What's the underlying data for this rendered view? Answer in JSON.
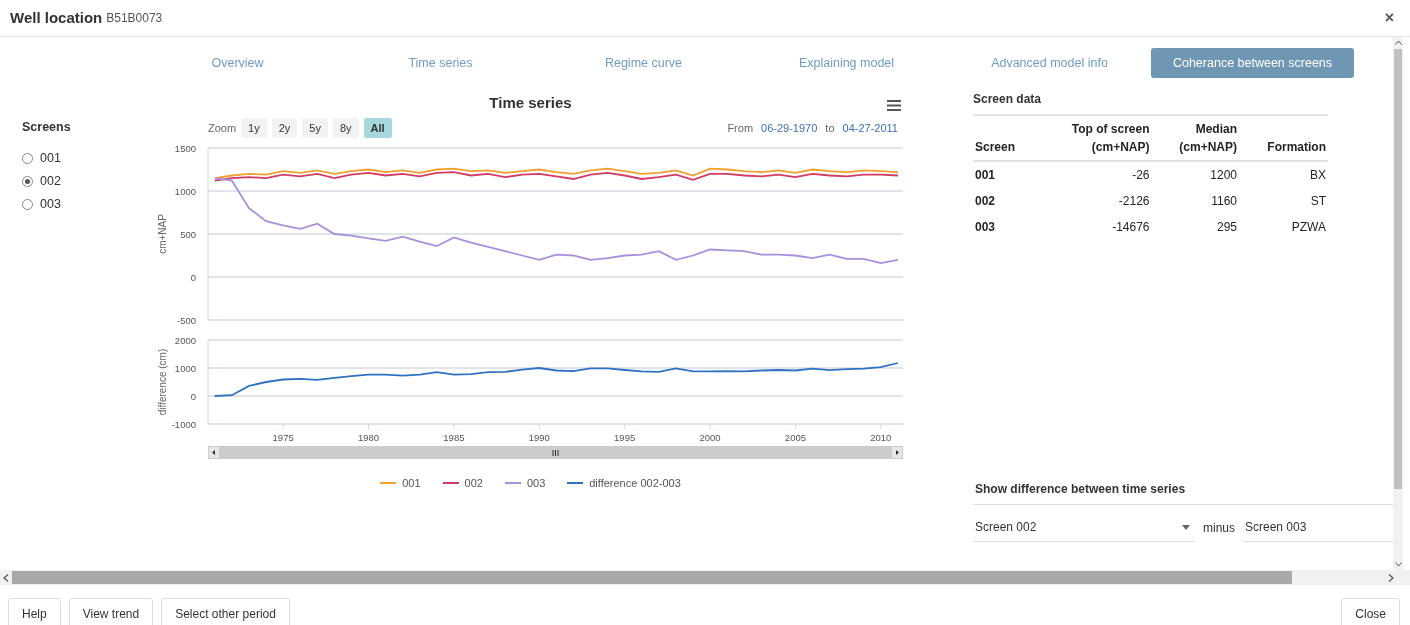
{
  "dialog": {
    "title": "Well location",
    "subtitle": "B51B0073",
    "close_icon": "×"
  },
  "tabs": [
    {
      "label": "Overview",
      "selected": false
    },
    {
      "label": "Time series",
      "selected": false
    },
    {
      "label": "Regime curve",
      "selected": false
    },
    {
      "label": "Explaining model",
      "selected": false
    },
    {
      "label": "Advanced model info",
      "selected": false
    },
    {
      "label": "Coherance between screens",
      "selected": true
    }
  ],
  "screens": {
    "title": "Screens",
    "items": [
      {
        "label": "001",
        "selected": false
      },
      {
        "label": "002",
        "selected": true
      },
      {
        "label": "003",
        "selected": false
      }
    ]
  },
  "chart_panel": {
    "title": "Time series",
    "zoom_label": "Zoom",
    "zoom_buttons": [
      {
        "label": "1y",
        "selected": false
      },
      {
        "label": "2y",
        "selected": false
      },
      {
        "label": "5y",
        "selected": false
      },
      {
        "label": "8y",
        "selected": false
      },
      {
        "label": "All",
        "selected": true
      }
    ],
    "from_label": "From",
    "from_date": "06-29-1970",
    "to_label": "to",
    "to_date": "04-27-2011",
    "upper_plot": {
      "chart_data": {
        "type": "line",
        "ylabel": "cm+NAP",
        "grid": true,
        "x": [
          1971,
          1972,
          1973,
          1974,
          1975,
          1976,
          1977,
          1978,
          1979,
          1980,
          1981,
          1982,
          1983,
          1984,
          1985,
          1986,
          1987,
          1988,
          1989,
          1990,
          1991,
          1992,
          1993,
          1994,
          1995,
          1996,
          1997,
          1998,
          1999,
          2000,
          2001,
          2002,
          2003,
          2004,
          2005,
          2006,
          2007,
          2008,
          2009,
          2010,
          2011
        ],
        "xlim": [
          1970.6,
          2011.3
        ],
        "ylim": [
          -500,
          1500
        ],
        "yticks": [
          -500,
          0,
          500,
          1000,
          1500
        ],
        "series": [
          {
            "name": "001",
            "color": "#f0a030",
            "values": [
              1150,
              1180,
              1200,
              1190,
              1230,
              1210,
              1240,
              1200,
              1230,
              1250,
              1220,
              1240,
              1210,
              1250,
              1260,
              1230,
              1240,
              1210,
              1230,
              1250,
              1220,
              1200,
              1240,
              1260,
              1230,
              1200,
              1210,
              1240,
              1180,
              1260,
              1250,
              1230,
              1220,
              1240,
              1210,
              1250,
              1230,
              1220,
              1240,
              1230,
              1220
            ]
          },
          {
            "name": "002",
            "color": "#d03c64",
            "values": [
              1120,
              1150,
              1160,
              1150,
              1190,
              1170,
              1200,
              1150,
              1190,
              1210,
              1180,
              1200,
              1170,
              1210,
              1220,
              1180,
              1200,
              1160,
              1190,
              1200,
              1170,
              1140,
              1190,
              1210,
              1180,
              1140,
              1160,
              1190,
              1130,
              1200,
              1200,
              1180,
              1170,
              1190,
              1160,
              1200,
              1180,
              1170,
              1190,
              1190,
              1180
            ]
          },
          {
            "name": "003",
            "color": "#a890dc",
            "values": [
              1150,
              1120,
              800,
              650,
              600,
              560,
              620,
              500,
              480,
              450,
              420,
              470,
              410,
              360,
              460,
              400,
              350,
              300,
              250,
              200,
              260,
              250,
              200,
              220,
              250,
              260,
              300,
              200,
              250,
              320,
              310,
              300,
              260,
              260,
              250,
              220,
              260,
              210,
              210,
              160,
              200
            ]
          }
        ]
      }
    },
    "lower_plot": {
      "chart_data": {
        "type": "line",
        "ylabel": "difference (cm)",
        "grid": true,
        "x": [
          1971,
          1972,
          1973,
          1974,
          1975,
          1976,
          1977,
          1978,
          1979,
          1980,
          1981,
          1982,
          1983,
          1984,
          1985,
          1986,
          1987,
          1988,
          1989,
          1990,
          1991,
          1992,
          1993,
          1994,
          1995,
          1996,
          1997,
          1998,
          1999,
          2000,
          2001,
          2002,
          2003,
          2004,
          2005,
          2006,
          2007,
          2008,
          2009,
          2010,
          2011
        ],
        "xlim": [
          1970.6,
          2011.3
        ],
        "ylim": [
          -1000,
          2000
        ],
        "xticks": [
          1975,
          1980,
          1985,
          1990,
          1995,
          2000,
          2005,
          2010
        ],
        "yticks": [
          -1000,
          0,
          1000,
          2000
        ],
        "series": [
          {
            "name": "difference 002-003",
            "color": "#2f72c2",
            "values": [
              0,
              30,
              360,
              500,
              590,
              610,
              580,
              650,
              710,
              760,
              760,
              730,
              760,
              850,
              760,
              780,
              850,
              860,
              940,
              1000,
              910,
              890,
              990,
              990,
              930,
              880,
              860,
              990,
              880,
              880,
              890,
              880,
              910,
              930,
              910,
              980,
              920,
              960,
              980,
              1030,
              1180
            ]
          }
        ]
      }
    }
  },
  "screen_data": {
    "title": "Screen data",
    "columns": [
      "Screen",
      "Top of screen\n(cm+NAP)",
      "Median\n(cm+NAP)",
      "Formation"
    ],
    "rows": [
      [
        "001",
        "-26",
        "1200",
        "BX"
      ],
      [
        "002",
        "-2126",
        "1160",
        "ST"
      ],
      [
        "003",
        "-14676",
        "295",
        "PZWA"
      ]
    ]
  },
  "difference": {
    "title": "Show difference between time series",
    "left_select": "Screen 002",
    "operator": "minus",
    "right_value": "Screen 003"
  },
  "footer": {
    "left_buttons": [
      "Help",
      "View trend",
      "Select other period"
    ],
    "right_button": "Close"
  }
}
